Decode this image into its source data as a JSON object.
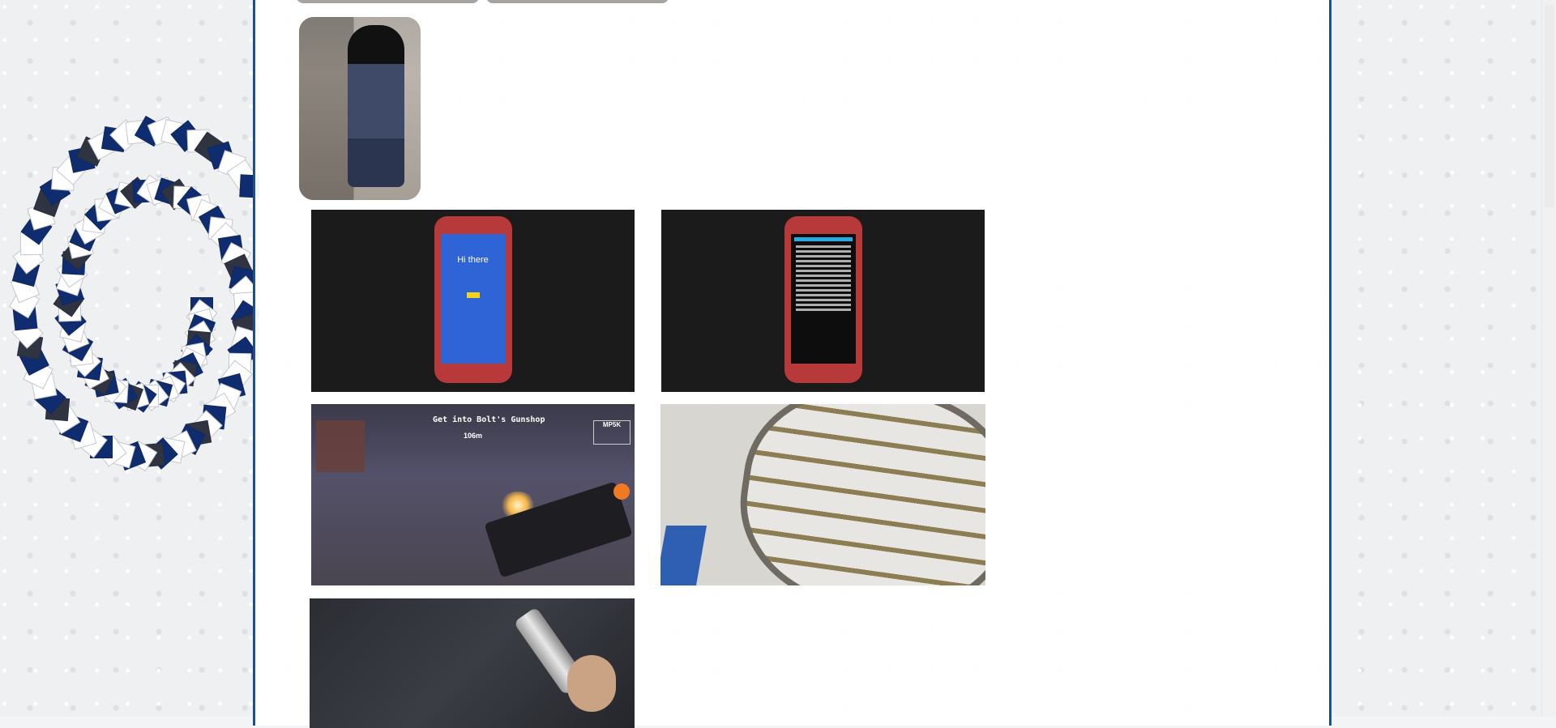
{
  "page": {
    "background_accent": "#1f4f8a",
    "content_border_color": "#1f4f8a"
  },
  "gallery": {
    "items": [
      {
        "kind": "photo",
        "subject": "person sitting against wall"
      },
      {
        "kind": "video",
        "subject": "phone setup screen",
        "screen_text": "Hi there"
      },
      {
        "kind": "video",
        "subject": "phone recovery terminal"
      },
      {
        "kind": "video",
        "subject": "first-person shooter game",
        "hud_text": "Get into Bolt's Gunshop",
        "distance": "106m",
        "weapon": "MP5K"
      },
      {
        "kind": "photo",
        "subject": "shoe sole"
      },
      {
        "kind": "video",
        "subject": "flashlight over jeans"
      }
    ]
  }
}
